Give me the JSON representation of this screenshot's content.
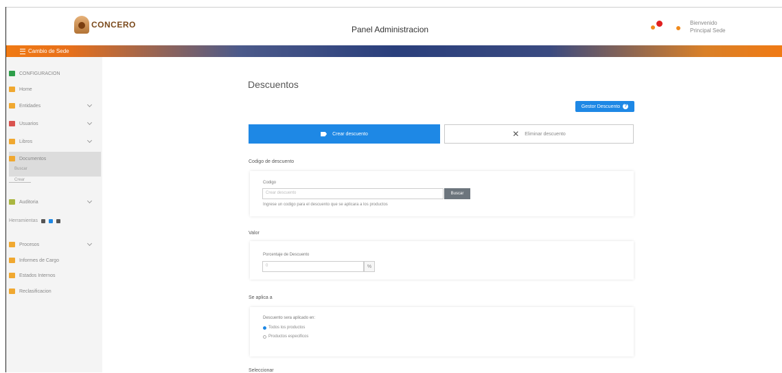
{
  "header": {
    "logo_text": "CONCERO",
    "title": "Panel Administracion",
    "user_line1": "Bienvenido",
    "user_line2": "Principal Sede"
  },
  "topbar": {
    "label": "Cambio de Sede"
  },
  "sidebar": {
    "items": [
      {
        "label": "CONFIGURACION",
        "color": "#2e9e4a"
      },
      {
        "label": "Home",
        "color": "#f0a830"
      },
      {
        "label": "Entidades",
        "color": "#f0a830"
      },
      {
        "label": "Usuarios",
        "color": "#d9534f"
      },
      {
        "label": "Libros",
        "color": "#f0a830"
      },
      {
        "label": "Documentos",
        "color": "#f0a830"
      },
      {
        "label": "Auditoria",
        "color": "#aab640"
      },
      {
        "label": "Procesos",
        "color": "#f0a830"
      },
      {
        "label": "Informes de Cargo",
        "color": "#f0a830"
      },
      {
        "label": "Estados Internos",
        "color": "#f0a830"
      },
      {
        "label": "Reclasificacion",
        "color": "#f0a830"
      }
    ],
    "active_sub1": "Buscar",
    "active_sub2": "Crear",
    "tools_label": "Herramientas"
  },
  "main": {
    "title": "Descuentos",
    "gestor_button": "Gestor Descuento",
    "tab_active": "Crear descuento",
    "tab_inactive": "Eliminar descuento",
    "section1": "Codigo de descuento",
    "code_label": "Codigo",
    "code_placeholder": "Crear descuento",
    "code_button": "Buscar",
    "code_help": "Ingrese un codigo para el descuento que se aplicara a los productos",
    "section2": "Valor",
    "percent_label": "Porcentaje de Descuento",
    "percent_value": "0",
    "section3": "Se aplica a",
    "apply_label": "Descuento sera aplicado en:",
    "radio1": "Todos los productos",
    "radio2": "Productos especificos",
    "section4": "Seleccionar"
  },
  "colors": {
    "accent": "#1e88e5",
    "brand_orange": "#f07a14"
  }
}
